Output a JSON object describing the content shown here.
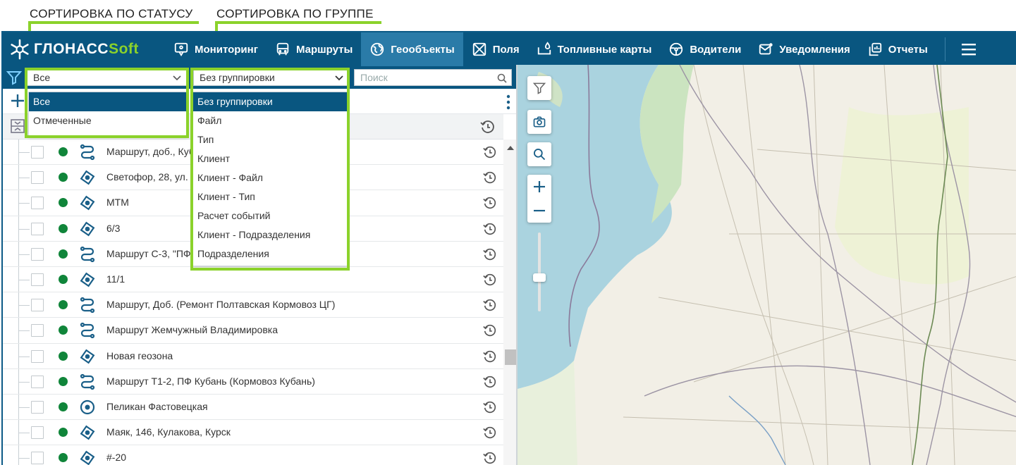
{
  "annotations": {
    "status_label": "СОРТИРОВКА ПО СТАТУСУ",
    "group_label": "СОРТИРОВКА ПО ГРУППЕ"
  },
  "brand": {
    "logo_main": "ГЛОНАСС",
    "logo_accent": "Soft",
    "primary_color": "#095680",
    "accent_color": "#8bd22b"
  },
  "nav": {
    "items": [
      {
        "label": "Мониторинг",
        "icon": "monitor-pin-icon",
        "active": false
      },
      {
        "label": "Маршруты",
        "icon": "bus-icon",
        "active": false
      },
      {
        "label": "Геообъекты",
        "icon": "globe-icon",
        "active": true
      },
      {
        "label": "Поля",
        "icon": "field-icon",
        "active": false
      },
      {
        "label": "Топливные карты",
        "icon": "fuel-card-icon",
        "active": false
      },
      {
        "label": "Водители",
        "icon": "steering-wheel-icon",
        "active": false
      },
      {
        "label": "Уведомления",
        "icon": "envelope-icon",
        "active": false
      },
      {
        "label": "Отчеты",
        "icon": "reports-icon",
        "active": false
      }
    ]
  },
  "filters": {
    "status_value": "Все",
    "group_value": "Без группировки",
    "search_placeholder": "Поиск"
  },
  "status_dropdown": {
    "options": [
      "Все",
      "Отмеченные"
    ],
    "selected": "Все"
  },
  "group_dropdown": {
    "options": [
      "Без группировки",
      "Файл",
      "Тип",
      "Клиент",
      "Клиент - Файл",
      "Клиент - Тип",
      "Расчет событий",
      "Клиент - Подразделения",
      "Подразделения"
    ],
    "selected": "Без группировки"
  },
  "rows": [
    {
      "type": "route",
      "name": "Маршрут, доб., Куб"
    },
    {
      "type": "zone",
      "name": "Светофор, 28, ул. Н"
    },
    {
      "type": "zone",
      "name": "МТМ"
    },
    {
      "type": "zone",
      "name": "6/3"
    },
    {
      "type": "route",
      "name": "Маршрут С-3, \"ПФ"
    },
    {
      "type": "zone",
      "name": "11/1"
    },
    {
      "type": "route",
      "name": "Маршрут, Доб. (Ремонт Полтавская Кормовоз ЦГ)"
    },
    {
      "type": "route",
      "name": "Маршрут Жемчужный Владимировка"
    },
    {
      "type": "zone",
      "name": "Новая геозона"
    },
    {
      "type": "route",
      "name": "Маршрут Т1-2, ПФ Кубань (Кормовоз Кубань)"
    },
    {
      "type": "point",
      "name": "Пеликан Фастовецкая"
    },
    {
      "type": "zone",
      "name": "Маяк, 146, Кулакова, Курск"
    },
    {
      "type": "zone",
      "name": "#-20"
    }
  ],
  "status_color": "#10853a"
}
